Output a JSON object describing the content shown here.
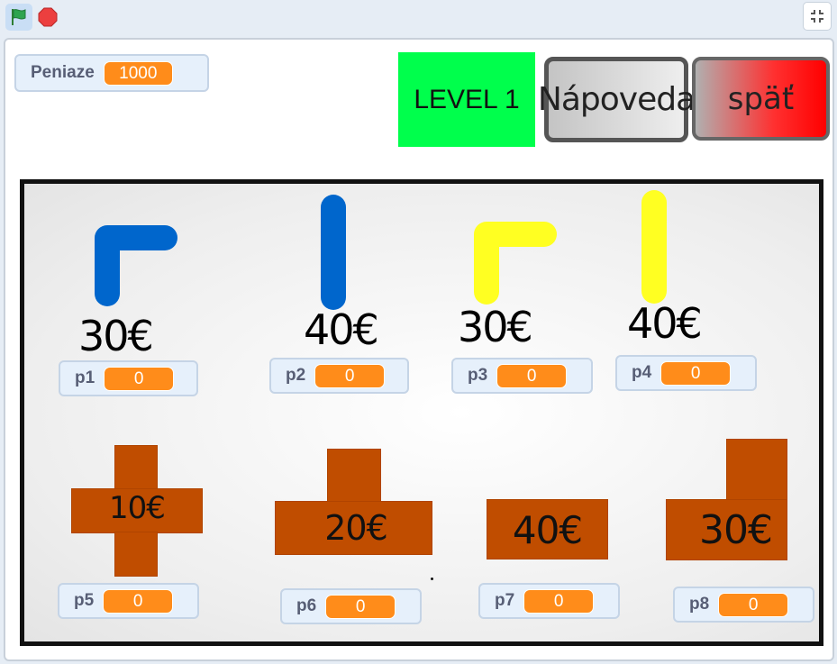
{
  "toolbar": {
    "flag_icon": "green-flag-icon",
    "stop_icon": "stop-sign-icon",
    "fullscreen_icon": "shrink-icon",
    "flag_color": "#2ea44f",
    "stop_color": "#ec3f3f"
  },
  "money": {
    "label": "Peniaze",
    "value": "1000"
  },
  "level": {
    "label": "LEVEL 1",
    "color": "#00ff4c"
  },
  "buttons": {
    "help": "Nápoveda",
    "back": "späť"
  },
  "pieces": [
    {
      "id": "p1",
      "label": "p1",
      "value": "0",
      "price": "30€",
      "color": "#0066cc",
      "shape": "corner"
    },
    {
      "id": "p2",
      "label": "p2",
      "value": "0",
      "price": "40€",
      "color": "#0066cc",
      "shape": "straight"
    },
    {
      "id": "p3",
      "label": "p3",
      "value": "0",
      "price": "30€",
      "color": "#ffff22",
      "shape": "corner"
    },
    {
      "id": "p4",
      "label": "p4",
      "value": "0",
      "price": "40€",
      "color": "#ffff22",
      "shape": "straight"
    },
    {
      "id": "p5",
      "label": "p5",
      "value": "0",
      "price": "10€",
      "color": "#c04d00",
      "shape": "cross"
    },
    {
      "id": "p6",
      "label": "p6",
      "value": "0",
      "price": "20€",
      "color": "#c04d00",
      "shape": "tee"
    },
    {
      "id": "p7",
      "label": "p7",
      "value": "0",
      "price": "40€",
      "color": "#c04d00",
      "shape": "straight-block"
    },
    {
      "id": "p8",
      "label": "p8",
      "value": "0",
      "price": "30€",
      "color": "#c04d00",
      "shape": "corner-block"
    }
  ]
}
